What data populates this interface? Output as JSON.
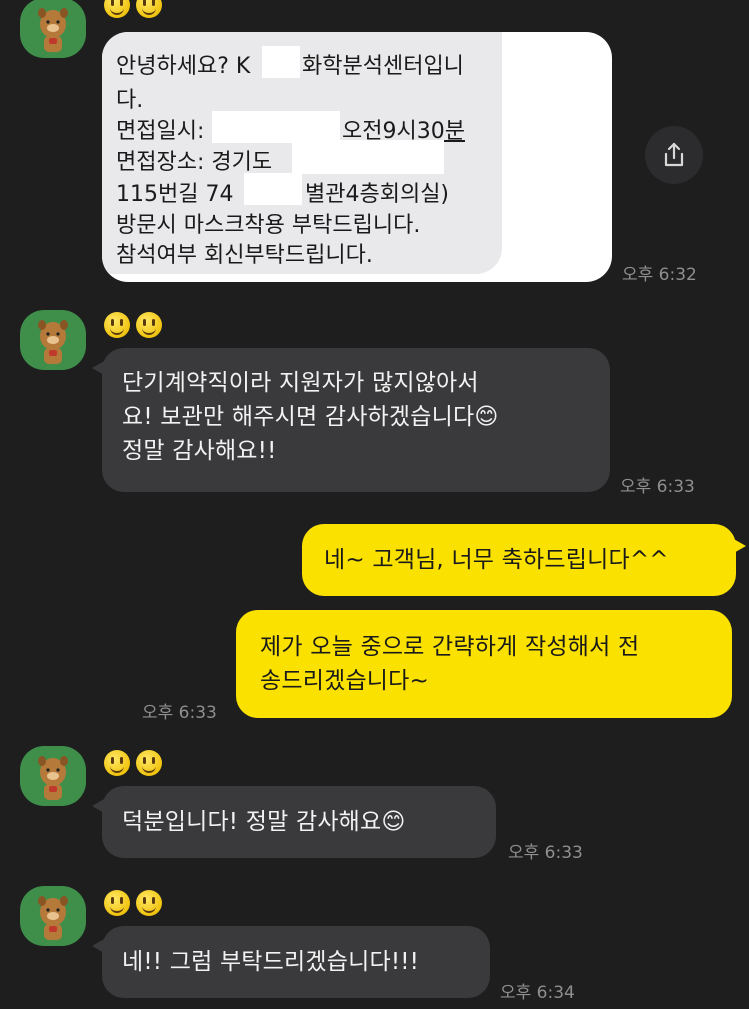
{
  "shared_card": {
    "lines": [
      "안녕하세요? K",
      "화학분석센터입니",
      "다.",
      "면접일시:",
      "오전9시30분",
      "면접장소: 경기도",
      "115번길 74",
      "별관4층회의실)",
      "방문시 마스크착용 부탁드립니다.",
      "참석여부 회신부탁드립니다."
    ],
    "time": "오후 6:32"
  },
  "messages": [
    {
      "type": "incoming",
      "text": "단기계약직이라 지원자가 많지않아서\n요! 보관만 해주시면 감사하겠습니다😊\n정말 감사해요!!",
      "time": "오후 6:33"
    },
    {
      "type": "outgoing",
      "text": "네~ 고객님, 너무 축하드립니다^^"
    },
    {
      "type": "outgoing",
      "text": "제가 오늘 중으로 간략하게 작성해서 전\n송드리겠습니다~",
      "time": "오후 6:33"
    },
    {
      "type": "incoming",
      "text": "덕분입니다! 정말 감사해요😊",
      "time": "오후 6:33"
    },
    {
      "type": "incoming",
      "text": "네!! 그럼 부탁드리겠습니다!!!",
      "time": "오후 6:34"
    }
  ],
  "icons": {
    "avatar": "bear-character-avatar-icon",
    "emoji": "smiley-face-icon",
    "share": "share-upload-icon"
  },
  "colors": {
    "background": "#1e1e1e",
    "incoming_bubble": "#3a3a3c",
    "outgoing_bubble": "#fae100",
    "avatar_bg": "#3f8f4a"
  }
}
